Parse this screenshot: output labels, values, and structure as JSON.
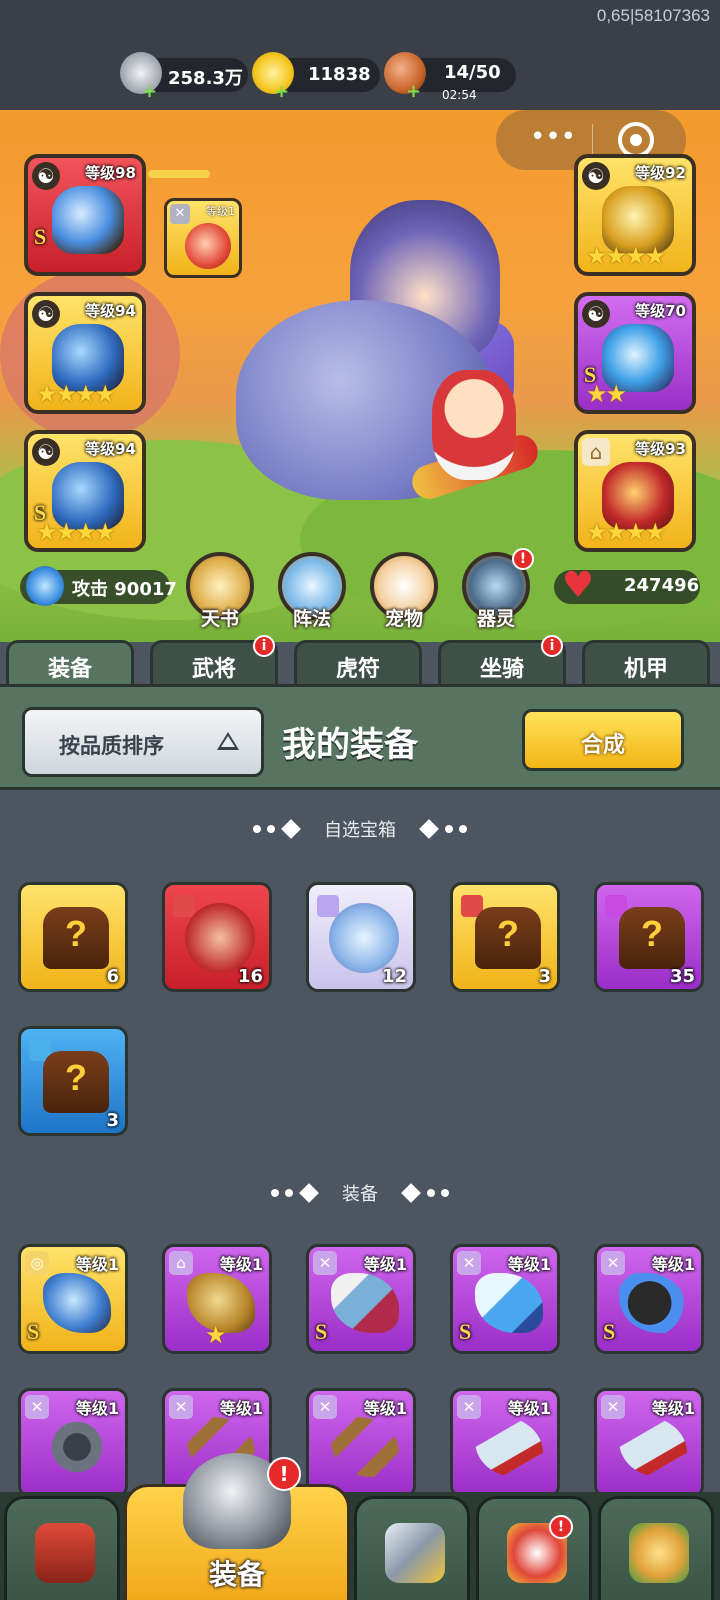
{
  "build_id": "0,65|58107363",
  "resources": [
    {
      "name": "silver",
      "value": "258.3万",
      "icon": "silver-coin-icon",
      "color": "#d9dde2"
    },
    {
      "name": "gold-ingot",
      "value": "11838",
      "icon": "gold-ingot-icon",
      "color": "#f5c61e"
    },
    {
      "name": "stamina",
      "value": "14/50",
      "timer": "02:54",
      "icon": "meat-icon",
      "color": "#c8652a"
    }
  ],
  "plus_symbol": "+",
  "capsule": {
    "more": "•••",
    "close_icon": "target-icon"
  },
  "hero_gear": {
    "left": [
      {
        "level": "等级98",
        "grade": "S",
        "quality": "red",
        "stars": ""
      },
      {
        "level": "等级94",
        "grade": "",
        "quality": "gold",
        "stars": "★★★★"
      },
      {
        "level": "等级94",
        "grade": "S",
        "quality": "gold",
        "stars": "★★★★"
      }
    ],
    "right": [
      {
        "level": "等级92",
        "grade": "",
        "quality": "gold",
        "stars": "★★★★"
      },
      {
        "level": "等级70",
        "grade": "S",
        "quality": "purple",
        "stars": "★★"
      },
      {
        "level": "等级93",
        "grade": "",
        "quality": "gold",
        "stars": "★★★★"
      }
    ],
    "linked": {
      "level": "等级1",
      "stars": "★★★"
    },
    "yinyang": "☯"
  },
  "stats": {
    "attack_label": "攻击 90017",
    "hp_value": "247496",
    "heart": "♥"
  },
  "features": [
    {
      "label": "天书",
      "badge": ""
    },
    {
      "label": "阵法",
      "badge": ""
    },
    {
      "label": "宠物",
      "badge": ""
    },
    {
      "label": "器灵",
      "badge": "!"
    }
  ],
  "tabs": [
    {
      "label": "装备",
      "active": true,
      "badge": ""
    },
    {
      "label": "武将",
      "active": false,
      "badge": "i"
    },
    {
      "label": "虎符",
      "active": false,
      "badge": ""
    },
    {
      "label": "坐骑",
      "active": false,
      "badge": "i"
    },
    {
      "label": "机甲",
      "active": false,
      "badge": ""
    }
  ],
  "equipment_header": {
    "sort_label": "按品质排序",
    "title": "我的装备",
    "synth_label": "合成"
  },
  "sections": {
    "chests": "自选宝箱",
    "equipment": "装备"
  },
  "chest_items": [
    {
      "quality": "gold",
      "kind": "chest",
      "count": "6"
    },
    {
      "quality": "red",
      "kind": "orb",
      "count": "16"
    },
    {
      "quality": "white",
      "kind": "orb",
      "count": "12"
    },
    {
      "quality": "gold",
      "kind": "chest",
      "count": "3"
    },
    {
      "quality": "purple",
      "kind": "chest",
      "count": "35"
    },
    {
      "quality": "blue",
      "kind": "chest",
      "count": "3"
    }
  ],
  "equipment_items": [
    {
      "quality": "gold",
      "level": "等级1",
      "art": "w-helm",
      "grade": "S",
      "star": ""
    },
    {
      "quality": "purple",
      "level": "等级1",
      "art": "w-boots",
      "grade": "",
      "star": "★"
    },
    {
      "quality": "purple",
      "level": "等级1",
      "art": "w-blade",
      "grade": "S",
      "star": ""
    },
    {
      "quality": "purple",
      "level": "等级1",
      "art": "w-sword",
      "grade": "S",
      "star": ""
    },
    {
      "quality": "purple",
      "level": "等级1",
      "art": "w-bomb",
      "grade": "S",
      "star": ""
    },
    {
      "quality": "purple",
      "level": "等级1",
      "art": "w-star",
      "grade": "",
      "star": ""
    },
    {
      "quality": "purple",
      "level": "等级1",
      "art": "w-bow",
      "grade": "",
      "star": ""
    },
    {
      "quality": "purple",
      "level": "等级1",
      "art": "w-bow",
      "grade": "",
      "star": ""
    },
    {
      "quality": "purple",
      "level": "等级1",
      "art": "w-saber",
      "grade": "",
      "star": ""
    },
    {
      "quality": "purple",
      "level": "等级1",
      "art": "w-saber",
      "grade": "",
      "star": ""
    }
  ],
  "bottom_nav": [
    {
      "name": "city",
      "icon": "city-gate-icon",
      "label": "",
      "badge": ""
    },
    {
      "name": "equipment",
      "icon": "helmet-icon",
      "label": "装备",
      "badge": "!",
      "active": true
    },
    {
      "name": "battle",
      "icon": "crossed-swords-icon",
      "label": "",
      "badge": ""
    },
    {
      "name": "heroes",
      "icon": "hero-stars-icon",
      "label": "",
      "badge": "!"
    },
    {
      "name": "upgrade",
      "icon": "fist-upgrade-icon",
      "label": "",
      "badge": ""
    }
  ]
}
